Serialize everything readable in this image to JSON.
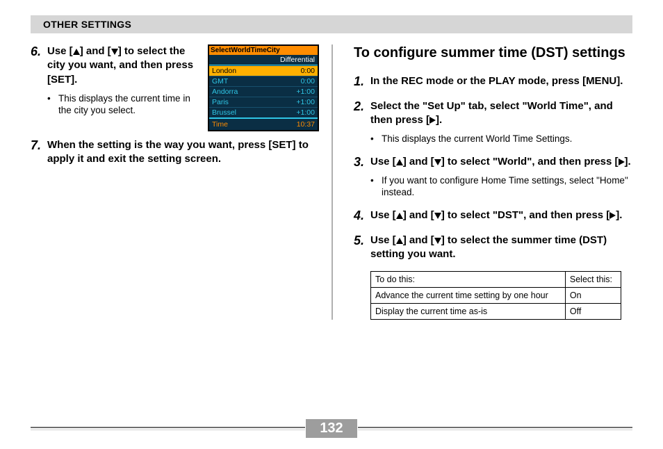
{
  "header": {
    "title": "OTHER SETTINGS"
  },
  "left": {
    "step6": {
      "num": "6.",
      "main_parts": [
        "Use [",
        "] and [",
        "] to select the city you want, and then press [SET]."
      ],
      "bullet": "This displays the current time in the city you select."
    },
    "lcd": {
      "title": "SelectWorldTimeCity",
      "diff_label": "Differential",
      "rows": [
        {
          "city": "London",
          "diff": "0:00",
          "selected": true
        },
        {
          "city": "GMT",
          "diff": "0:00",
          "selected": false
        },
        {
          "city": "Andorra",
          "diff": "+1:00",
          "selected": false
        },
        {
          "city": "Paris",
          "diff": "+1:00",
          "selected": false
        },
        {
          "city": "Brussel",
          "diff": "+1:00",
          "selected": false
        }
      ],
      "time_label": "Time",
      "time_value": "10:37"
    },
    "step7": {
      "num": "7.",
      "main": "When the setting is the way you want, press [SET] to apply it and exit the setting screen."
    }
  },
  "right": {
    "title": "To configure summer time (DST) settings",
    "step1": {
      "num": "1.",
      "main": "In the REC mode or the PLAY mode, press [MENU]."
    },
    "step2": {
      "num": "2.",
      "main_parts": [
        "Select the \"Set Up\" tab, select \"World Time\", and then press [",
        "]."
      ],
      "bullet": "This displays the current World Time Settings."
    },
    "step3": {
      "num": "3.",
      "main_parts": [
        "Use [",
        "] and [",
        "] to select \"World\", and then press [",
        "]."
      ],
      "bullet": "If you want to configure Home Time settings, select \"Home\" instead."
    },
    "step4": {
      "num": "4.",
      "main_parts": [
        "Use [",
        "] and [",
        "] to select \"DST\", and then press [",
        "]."
      ]
    },
    "step5": {
      "num": "5.",
      "main_parts": [
        "Use [",
        "] and [",
        "] to select the summer time (DST) setting you want."
      ]
    },
    "table": {
      "head1": "To do this:",
      "head2": "Select this:",
      "rows": [
        {
          "action": "Advance the current time setting by one hour",
          "select": "On"
        },
        {
          "action": "Display the current time as-is",
          "select": "Off"
        }
      ]
    }
  },
  "page_number": "132"
}
